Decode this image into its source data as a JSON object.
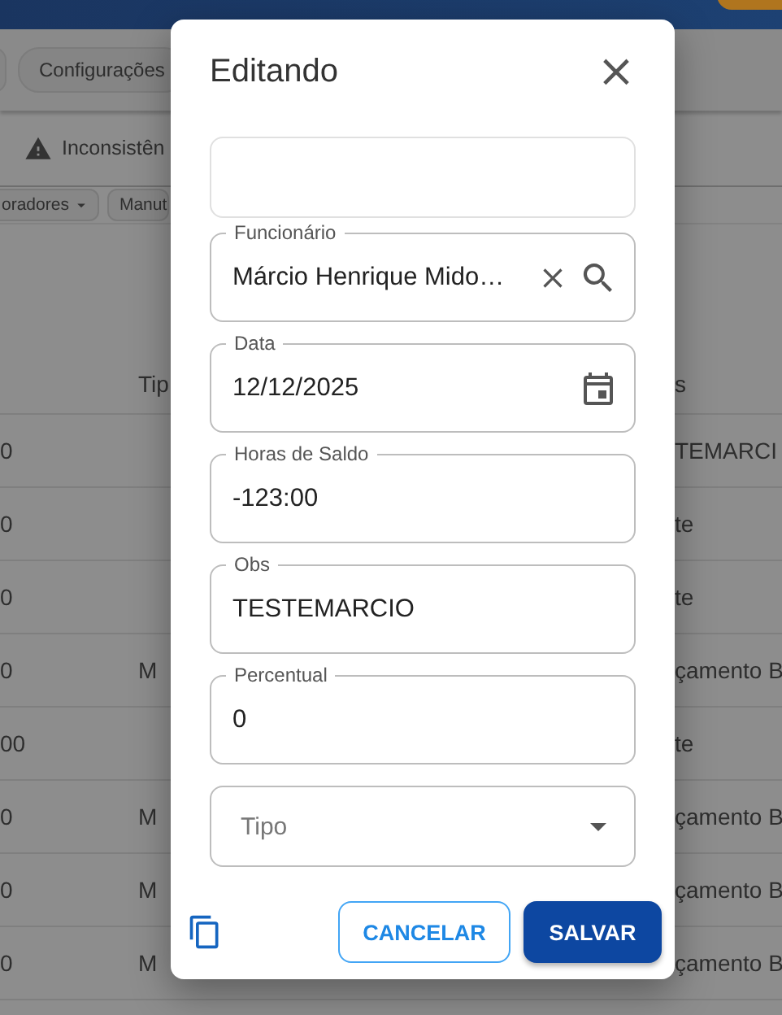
{
  "background": {
    "chips": [
      "Configurações"
    ],
    "tab": "Inconsistên",
    "filters": [
      "oradores",
      "Manut"
    ],
    "table": {
      "header": {
        "column_2": "Tip",
        "column_3": "s"
      },
      "rows": [
        {
          "column_1": "0",
          "column_2": "",
          "column_3": "TEMARCI"
        },
        {
          "column_1": "0",
          "column_2": "",
          "column_3": "te"
        },
        {
          "column_1": "0",
          "column_2": "",
          "column_3": "te"
        },
        {
          "column_1": "0",
          "column_2": "M",
          "column_3": "çamento B"
        },
        {
          "column_1": "00",
          "column_2": "",
          "column_3": "te"
        },
        {
          "column_1": "0",
          "column_2": "M",
          "column_3": "çamento B"
        },
        {
          "column_1": "0",
          "column_2": "M",
          "column_3": "çamento B"
        },
        {
          "column_1": "0",
          "column_2": "M",
          "column_3": "çamento B"
        }
      ]
    }
  },
  "dialog": {
    "title": "Editando",
    "close": "×",
    "fields": [
      {
        "kind": "text"
      },
      {
        "kind": "autocomplete",
        "label": "Funcionário",
        "value": "Márcio Henrique Mido…"
      },
      {
        "kind": "date",
        "label": "Data",
        "value": "12/12/2025"
      },
      {
        "kind": "text",
        "label": "Horas de Saldo",
        "value": "-123:00"
      },
      {
        "kind": "text",
        "label": "Obs",
        "value": "TESTEMARCIO"
      },
      {
        "kind": "text",
        "label": "Percentual",
        "value": "0"
      },
      {
        "kind": "select",
        "placeholder": "Tipo"
      }
    ],
    "buttons": [
      {
        "label": "CANCELAR",
        "kind": "outlined"
      },
      {
        "label": "SALVAR",
        "kind": "filled"
      }
    ]
  }
}
